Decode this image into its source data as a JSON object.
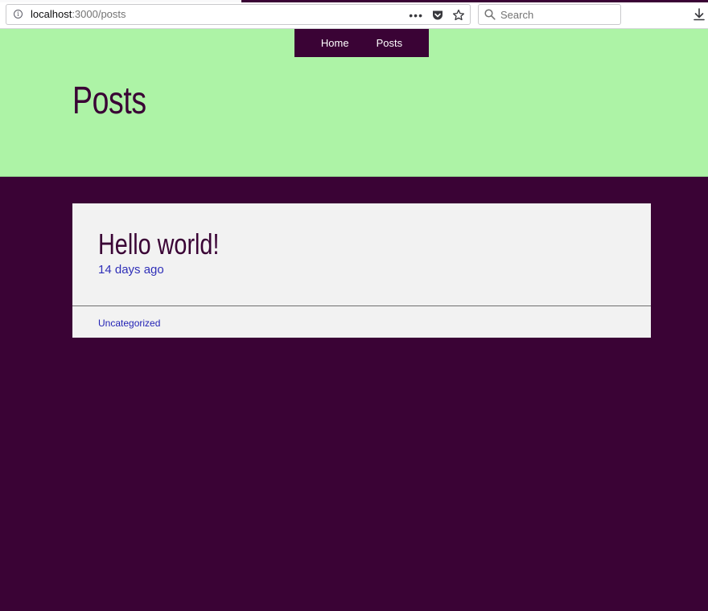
{
  "browser": {
    "url_host": "localhost",
    "url_path": ":3000/posts",
    "search_placeholder": "Search",
    "icons": [
      "info-icon",
      "more-actions-icon",
      "pocket-icon",
      "bookmark-star-icon",
      "search-icon",
      "download-icon"
    ]
  },
  "nav": {
    "items": [
      {
        "label": "Home"
      },
      {
        "label": "Posts"
      }
    ]
  },
  "page": {
    "title": "Posts"
  },
  "posts": [
    {
      "title": "Hello world!",
      "date": "14 days ago",
      "category": "Uncategorized"
    }
  ],
  "colors": {
    "hero_background": "#adf3a6",
    "page_background": "#3a0335",
    "card_background": "#f2f2f2",
    "title_color": "#3a0335",
    "link_color": "#2f2fb8"
  }
}
